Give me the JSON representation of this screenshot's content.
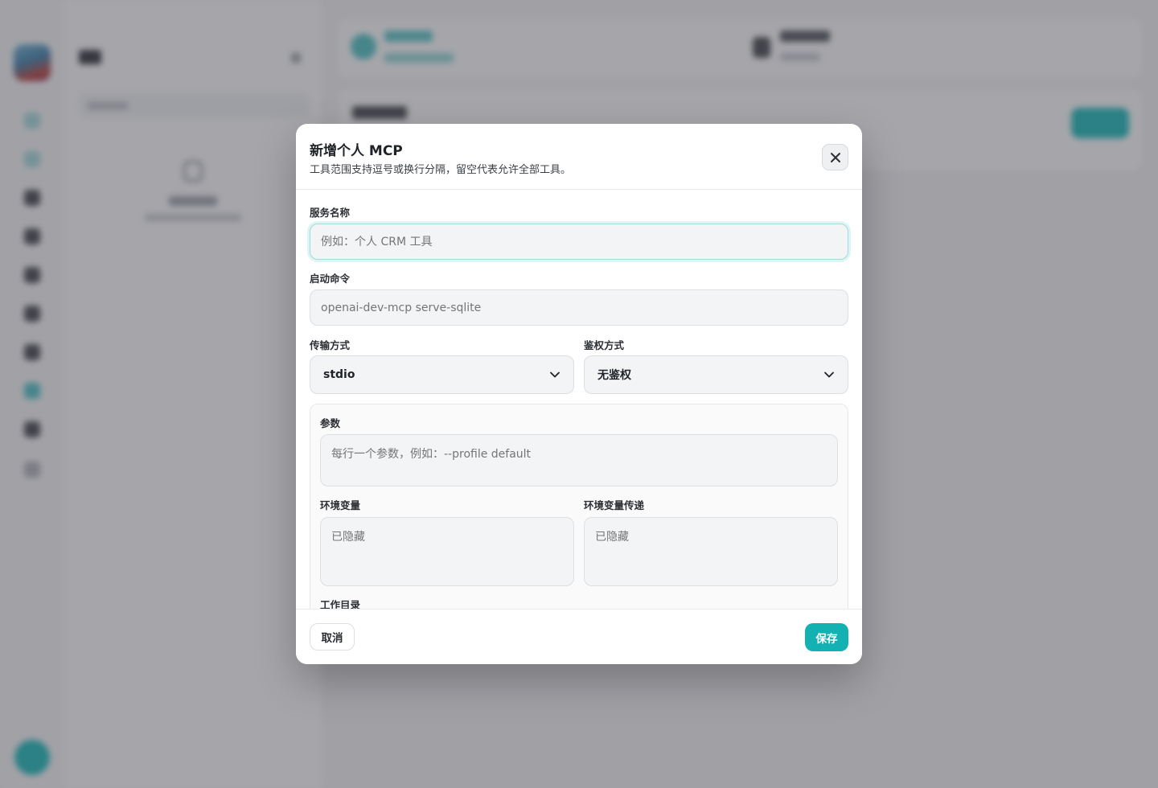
{
  "modal": {
    "title": "新增个人 MCP",
    "subtitle": "工具范围支持逗号或换行分隔，留空代表允许全部工具。",
    "close_icon": "close-icon"
  },
  "form": {
    "service_name": {
      "label": "服务名称",
      "value": "",
      "placeholder": "例如：个人 CRM 工具"
    },
    "command": {
      "label": "启动命令",
      "value": "",
      "placeholder": "openai-dev-mcp serve-sqlite"
    },
    "transport": {
      "label": "传输方式",
      "selected": "stdio"
    },
    "auth": {
      "label": "鉴权方式",
      "selected": "无鉴权"
    },
    "args": {
      "label": "参数",
      "value": "",
      "placeholder": "每行一个参数，例如：--profile default"
    },
    "env": {
      "label": "环境变量",
      "placeholder": "已隐藏"
    },
    "env_passthrough": {
      "label": "环境变量传递",
      "placeholder": "已隐藏"
    },
    "workdir": {
      "label": "工作目录"
    }
  },
  "footer": {
    "cancel_label": "取消",
    "save_label": "保存"
  },
  "colors": {
    "accent": "#14b1b3",
    "overlay": "rgba(68,70,78,0.48)"
  }
}
